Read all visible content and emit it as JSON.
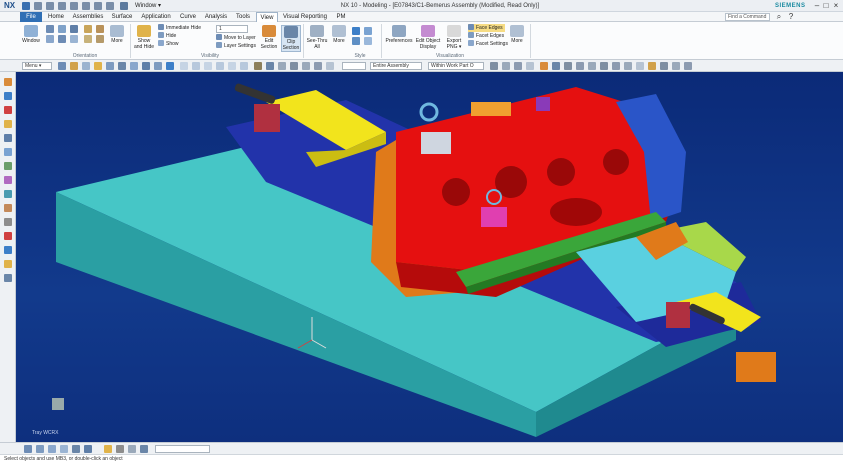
{
  "app": {
    "logo": "NX",
    "window_menu": "Window ▾",
    "title": "NX 10 - Modeling - [E07843/C1-Bemerus Assembly (Modified, Read Only)]",
    "brand": "SIEMENS"
  },
  "tabs": [
    {
      "label": "File",
      "style": "file"
    },
    {
      "label": "Home"
    },
    {
      "label": "Assemblies"
    },
    {
      "label": "Surface"
    },
    {
      "label": "Application"
    },
    {
      "label": "Curve"
    },
    {
      "label": "Analysis"
    },
    {
      "label": "Tools"
    },
    {
      "label": "View",
      "style": "active"
    },
    {
      "label": "Visual Reporting"
    },
    {
      "label": "PM"
    }
  ],
  "find_command": "Find a Command",
  "ribbon": {
    "orientation_group": "Orientation",
    "visibility_group": "Visibility",
    "style_group": "Style",
    "visualization_group": "Visualization",
    "window_label": "Window",
    "more_label": "More",
    "show_hide_label": "Show and Hide",
    "immediate_hide": "Immediate Hide",
    "hide": "Hide",
    "show": "Show",
    "layer_value": "1",
    "move_to_layer": "Move to Layer",
    "layer_settings": "Layer Settings",
    "edit_section": "Edit Section",
    "clip_section": "Clip Section",
    "see_thru_all": "See-Thru All",
    "more_label_2": "More",
    "preferences": "Preferences",
    "edit_object_display": "Edit Object Display",
    "export": "Export PNG ▾",
    "face_edges": "Face Edges",
    "facet_edges": "Facet Edges",
    "facet_settings": "Facet Settings",
    "more_label_3": "More"
  },
  "toolbar": {
    "menu_label": "Menu ▾",
    "filter_value": "",
    "scope_value": "Entire Assembly",
    "part_scope": "Within Work Part O"
  },
  "viewport": {
    "triad_label": "Tray WCRX"
  },
  "status": "Select objects and use MB3, or double-click an object",
  "colors": {
    "accent": "#2f6fb5",
    "viewport_top": "#0b2a78",
    "red_part": "#e01010",
    "cyan_base": "#45c3c4",
    "yellow_part": "#f2e41c"
  }
}
